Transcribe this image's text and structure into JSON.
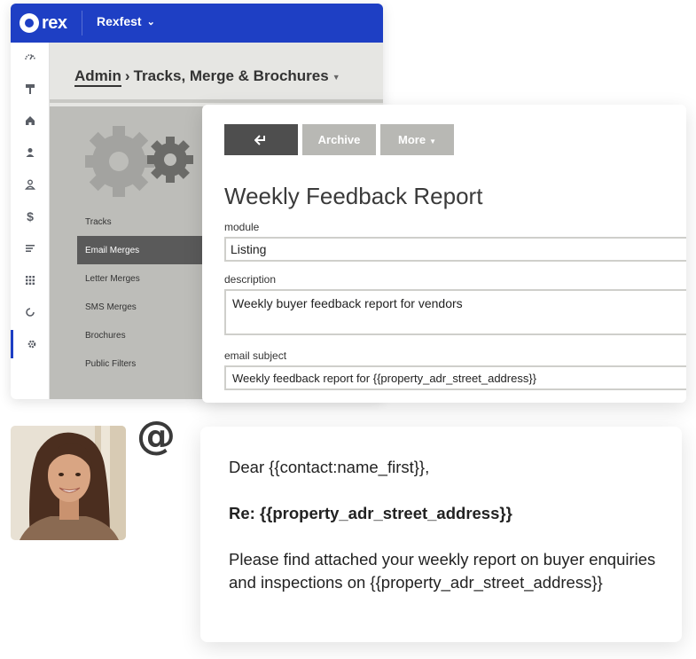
{
  "app": {
    "logo_text": "rex",
    "account_name": "Rexfest",
    "brand_color": "#1e3fc4",
    "sidebar_icons": [
      "dashboard-icon",
      "signpost-icon",
      "home-icon",
      "contact-icon",
      "person-badge-icon",
      "dollar-icon",
      "lines-icon",
      "grid-icon",
      "refresh-icon",
      "gear-icon"
    ]
  },
  "breadcrumb": {
    "root": "Admin",
    "separator": "›",
    "current": "Tracks, Merge & Brochures"
  },
  "side_menu": {
    "items": [
      {
        "label": "Tracks"
      },
      {
        "label": "Email Merges"
      },
      {
        "label": "Letter Merges"
      },
      {
        "label": "SMS Merges"
      },
      {
        "label": "Brochures"
      },
      {
        "label": "Public Filters"
      }
    ],
    "active_index": 1
  },
  "form": {
    "archive_label": "Archive",
    "more_label": "More",
    "title": "Weekly Feedback Report",
    "module_label": "module",
    "module_value": "Listing",
    "description_label": "description",
    "description_value": "Weekly buyer feedback report for vendors",
    "subject_label": "email subject",
    "subject_value": "Weekly feedback report for {{property_adr_street_address}}"
  },
  "email": {
    "at_symbol": "@",
    "greeting": "Dear {{contact:name_first}},",
    "re_line": "Re: {{property_adr_street_address}}",
    "body": "Please find attached your weekly report on buyer enquiries and inspections on {{property_adr_street_address}}"
  }
}
